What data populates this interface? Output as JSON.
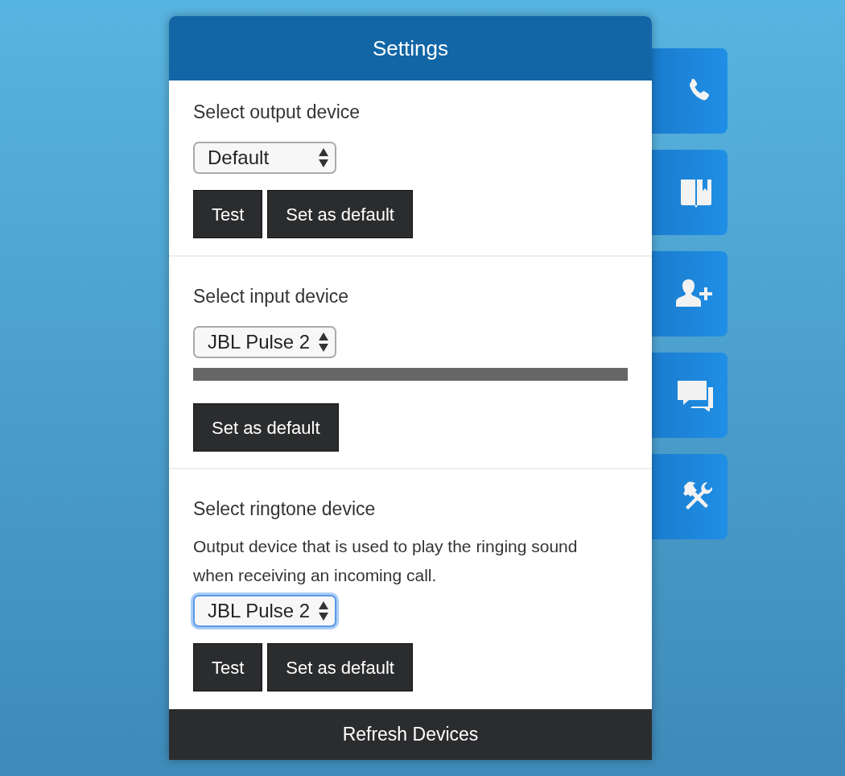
{
  "dialog": {
    "title": "Settings",
    "footer_button": "Refresh Devices"
  },
  "sections": [
    {
      "label": "Select output device",
      "select": {
        "value": "Default",
        "focused": false
      },
      "buttons": [
        "Test",
        "Set as default"
      ]
    },
    {
      "label": "Select input device",
      "select": {
        "value": "JBL Pulse 2",
        "focused": false
      },
      "meter": true,
      "buttons": [
        "Set as default"
      ]
    },
    {
      "label": "Select ringtone device",
      "description": "Output device that is used to play the ringing sound when receiving an incoming call.",
      "select": {
        "value": "JBL Pulse 2",
        "focused": true
      },
      "buttons": [
        "Test",
        "Set as default"
      ]
    }
  ],
  "side_tabs": [
    {
      "kind": "phone"
    },
    {
      "kind": "book"
    },
    {
      "kind": "add-user"
    },
    {
      "kind": "chat"
    },
    {
      "kind": "tools"
    }
  ]
}
